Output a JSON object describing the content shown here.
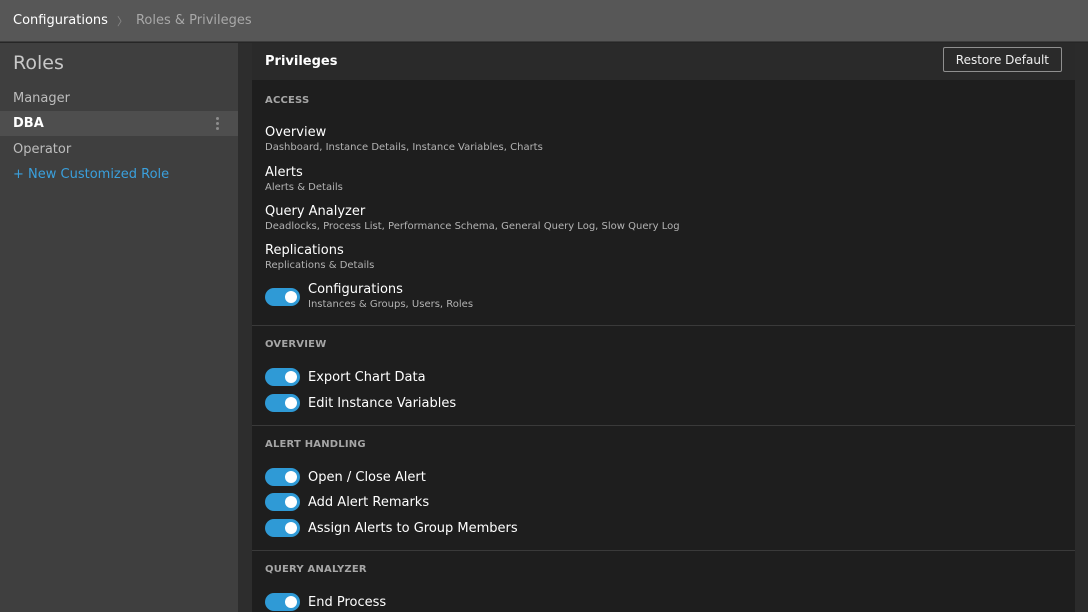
{
  "breadcrumb": {
    "root": "Configurations",
    "separator": "〉",
    "current": "Roles & Privileges"
  },
  "sidebar": {
    "title": "Roles",
    "roles": [
      {
        "label": "Manager"
      },
      {
        "label": "DBA"
      },
      {
        "label": "Operator"
      }
    ],
    "new_role_label": "+ New Customized Role"
  },
  "panel": {
    "title": "Privileges",
    "restore_label": "Restore Default"
  },
  "sections": {
    "access": {
      "label": "ACCESS",
      "items": [
        {
          "title": "Overview",
          "sub": "Dashboard, Instance Details, Instance Variables, Charts"
        },
        {
          "title": "Alerts",
          "sub": "Alerts & Details"
        },
        {
          "title": "Query Analyzer",
          "sub": "Deadlocks, Process List, Performance Schema, General Query Log, Slow Query Log"
        },
        {
          "title": "Replications",
          "sub": "Replications & Details"
        },
        {
          "title": "Configurations",
          "sub": "Instances & Groups, Users, Roles",
          "enabled": true
        }
      ]
    },
    "overview": {
      "label": "OVERVIEW",
      "toggles": [
        {
          "label": "Export Chart Data",
          "enabled": true
        },
        {
          "label": "Edit Instance Variables",
          "enabled": true
        }
      ]
    },
    "alert_handling": {
      "label": "ALERT HANDLING",
      "toggles": [
        {
          "label": "Open / Close Alert",
          "enabled": true
        },
        {
          "label": "Add Alert Remarks",
          "enabled": true
        },
        {
          "label": "Assign Alerts to Group Members",
          "enabled": true
        }
      ]
    },
    "query_analyzer": {
      "label": "QUERY ANALYZER",
      "toggles": [
        {
          "label": "End Process",
          "enabled": true
        }
      ]
    }
  },
  "colors": {
    "accent": "#2f9ad6",
    "link": "#3aa0dd"
  }
}
